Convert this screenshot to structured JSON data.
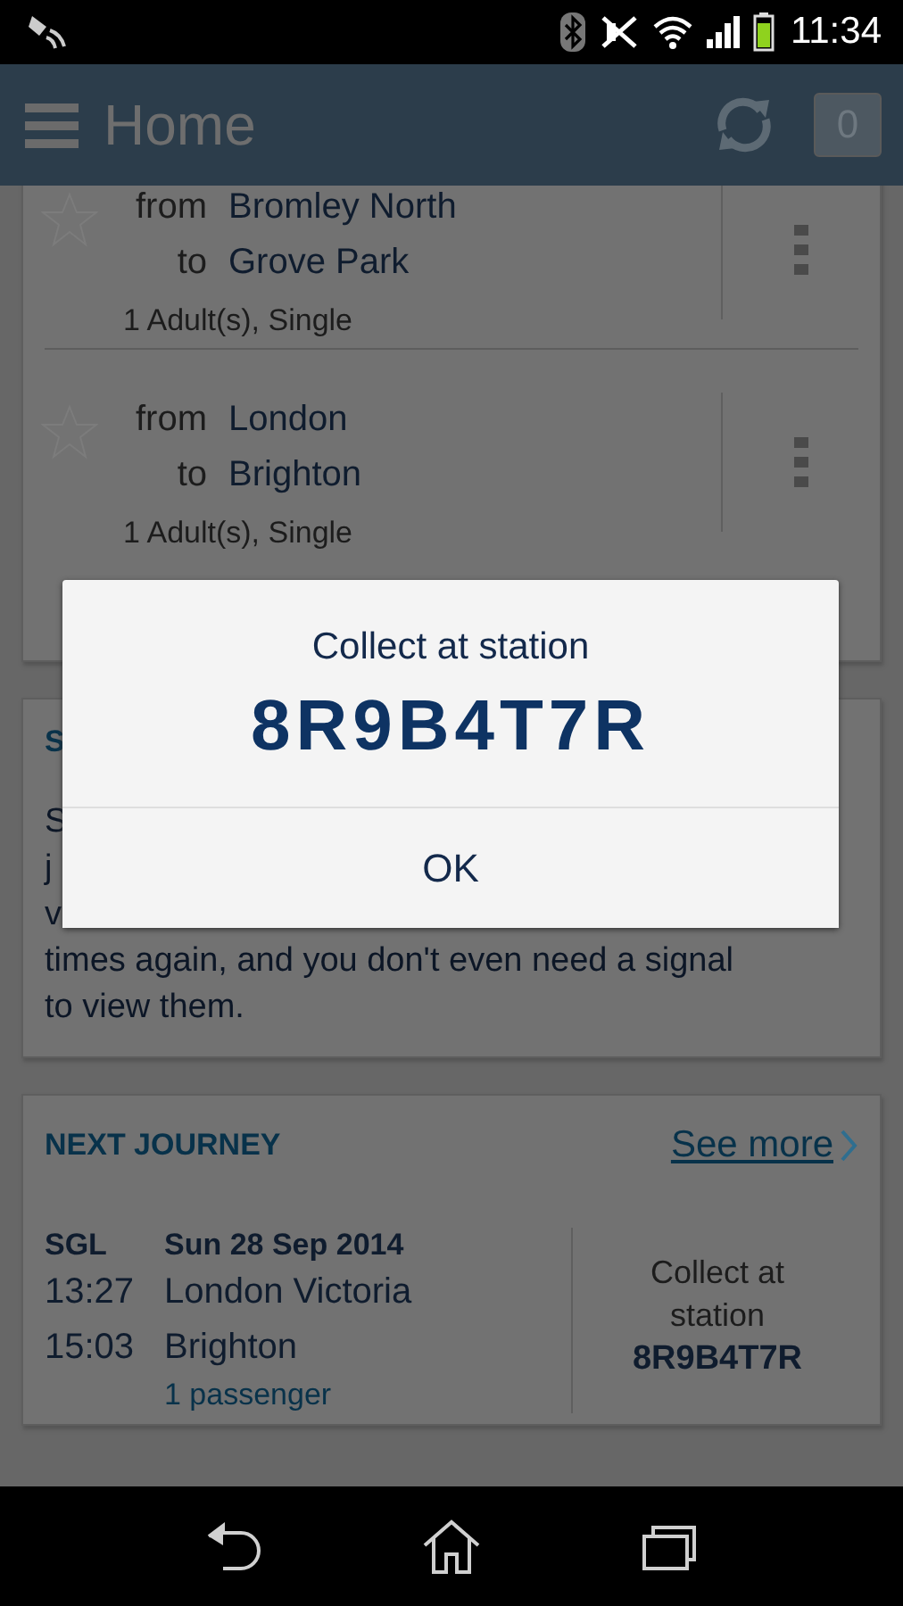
{
  "status_bar": {
    "time": "11:34"
  },
  "app_bar": {
    "title": "Home",
    "badge": "0"
  },
  "saved_journeys": [
    {
      "from_label": "from",
      "from": "Bromley North",
      "to_label": "to",
      "to": "Grove Park",
      "details": "1 Adult(s), Single",
      "favorite": false
    },
    {
      "from_label": "from",
      "from": "London",
      "to_label": "to",
      "to": "Brighton",
      "details": "1 Adult(s), Single",
      "favorite": false
    }
  ],
  "info_card": {
    "heading": "S",
    "lines": [
      "S",
      "j",
      "v",
      "times again, and you don't even need a signal",
      "to view them."
    ]
  },
  "next_journey": {
    "heading": "NEXT JOURNEY",
    "link": "See more",
    "ticket_type": "SGL",
    "date": "Sun 28 Sep 2014",
    "stops": [
      {
        "time": "13:27",
        "station": "London Victoria"
      },
      {
        "time": "15:03",
        "station": "Brighton"
      }
    ],
    "passengers": "1 passenger",
    "collect_label": "Collect at station",
    "code": "8R9B4T7R"
  },
  "dialog": {
    "title": "Collect at station",
    "code": "8R9B4T7R",
    "button": "OK"
  }
}
